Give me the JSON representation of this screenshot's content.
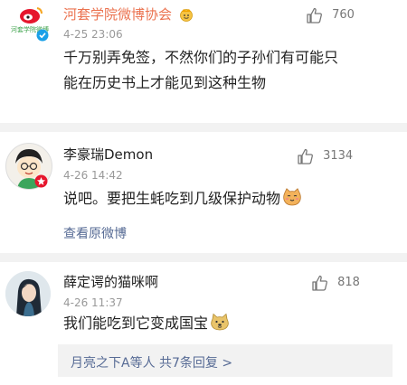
{
  "comments": [
    {
      "author": "河套学院微博协会",
      "avatar_text": "河套学院微博",
      "time": "4-25 23:06",
      "text_line1": "千万别弄免签，不然你们的子孙们有可能只",
      "text_line2": "能在历史书上才能见到这种生物",
      "likes": "760",
      "name_color": "#eb7350"
    },
    {
      "author": "李豪瑞Demon",
      "time": "4-26 14:42",
      "text": "说吧。要把生蚝吃到几级保护动物",
      "likes": "3134",
      "link": "查看原微博"
    },
    {
      "author": "薛定谔的猫咪啊",
      "time": "4-26 11:37",
      "text": "我们能吃到它变成国宝",
      "likes": "818",
      "reply_summary": "月亮之下A等人  共7条回复 >"
    }
  ],
  "colors": {
    "link": "#576b95",
    "accent": "#eb7350",
    "divider": "#f2f2f2"
  },
  "icons": [
    "thumb-up-icon",
    "verified-badge-icon",
    "cat-emoji-icon",
    "doge-emoji-icon",
    "crown-emoji-icon"
  ]
}
